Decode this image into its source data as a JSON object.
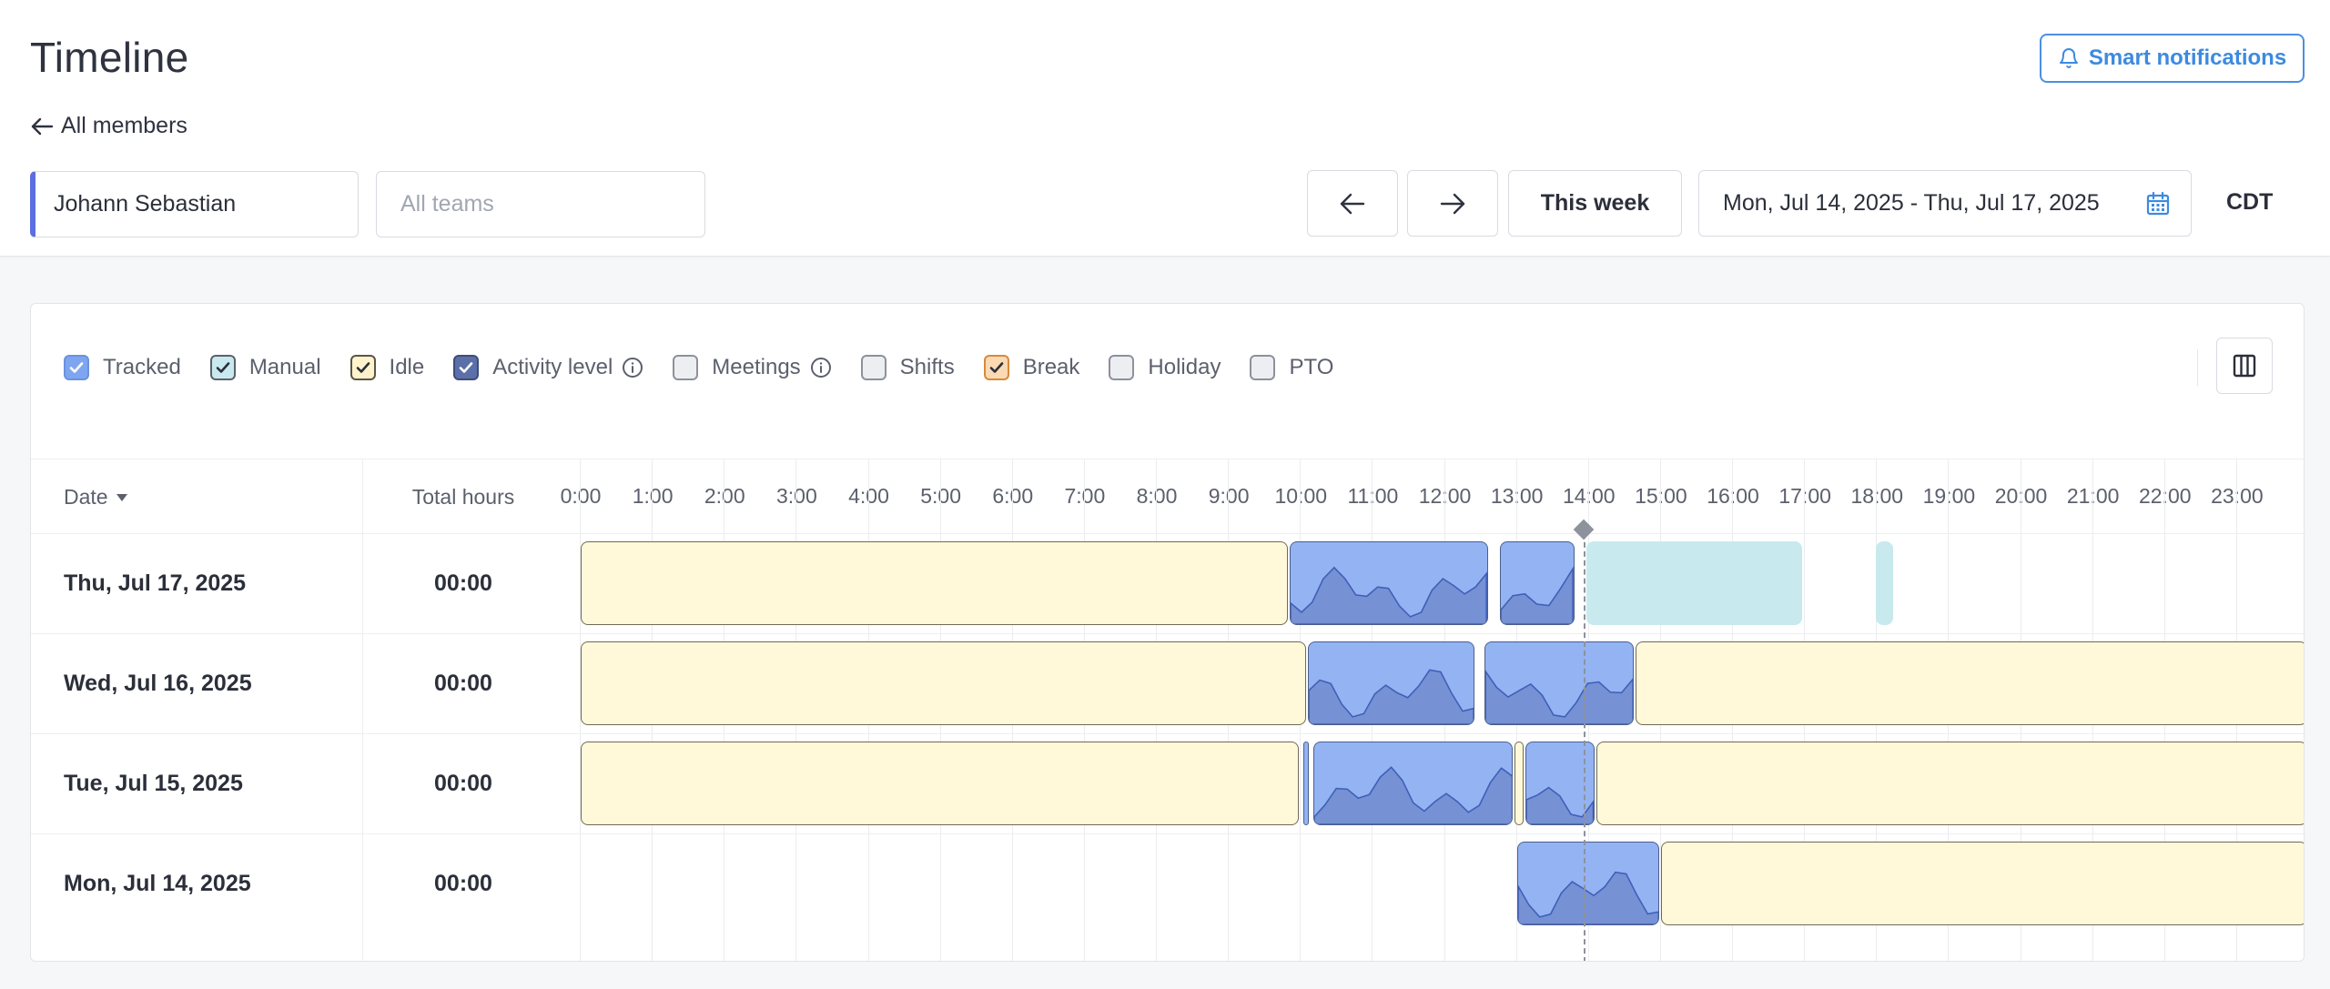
{
  "header": {
    "title": "Timeline",
    "smart_notifications_label": "Smart notifications",
    "back_link_label": "All members",
    "member_value": "Johann Sebastian",
    "teams_placeholder": "All teams",
    "this_week_label": "This week",
    "date_range": "Mon, Jul 14, 2025 - Thu, Jul 17, 2025",
    "timezone": "CDT"
  },
  "legend": {
    "items": [
      {
        "label": "Tracked",
        "checked": true,
        "color": "#7ea6f0"
      },
      {
        "label": "Manual",
        "checked": true,
        "color": "#c8eaee"
      },
      {
        "label": "Idle",
        "checked": true,
        "color": "#fff3cc"
      },
      {
        "label": "Activity level",
        "checked": true,
        "color": "#5b6fa8",
        "info": true
      },
      {
        "label": "Meetings",
        "checked": false,
        "info": true
      },
      {
        "label": "Shifts",
        "checked": false
      },
      {
        "label": "Break",
        "checked": true,
        "color": "#fbd9b3"
      },
      {
        "label": "Holiday",
        "checked": false
      },
      {
        "label": "PTO",
        "checked": false
      }
    ]
  },
  "table": {
    "date_header": "Date",
    "total_header": "Total hours",
    "hours": [
      "0:00",
      "1:00",
      "2:00",
      "3:00",
      "4:00",
      "5:00",
      "6:00",
      "7:00",
      "8:00",
      "9:00",
      "10:00",
      "11:00",
      "12:00",
      "13:00",
      "14:00",
      "15:00",
      "16:00",
      "17:00",
      "18:00",
      "19:00",
      "20:00",
      "21:00",
      "22:00",
      "23:00"
    ],
    "rows": [
      {
        "date": "Thu, Jul 17, 2025",
        "total": "00:00",
        "segments": [
          {
            "type": "idle",
            "start": 0.0,
            "end": 9.85
          },
          {
            "type": "tracked",
            "start": 9.85,
            "end": 12.62
          },
          {
            "type": "tracked",
            "start": 12.77,
            "end": 13.82
          },
          {
            "type": "manual",
            "start": 13.96,
            "end": 16.98
          },
          {
            "type": "manual",
            "start": 17.98,
            "end": 18.25
          }
        ]
      },
      {
        "date": "Wed, Jul 16, 2025",
        "total": "00:00",
        "segments": [
          {
            "type": "idle",
            "start": 0.0,
            "end": 10.1
          },
          {
            "type": "tracked",
            "start": 10.1,
            "end": 12.44
          },
          {
            "type": "tracked",
            "start": 12.55,
            "end": 14.65
          },
          {
            "type": "idle",
            "start": 14.65,
            "end": 24.0
          }
        ]
      },
      {
        "date": "Tue, Jul 15, 2025",
        "total": "00:00",
        "segments": [
          {
            "type": "idle",
            "start": 0.0,
            "end": 10.0
          },
          {
            "type": "tracked",
            "start": 10.04,
            "end": 10.12
          },
          {
            "type": "tracked",
            "start": 10.17,
            "end": 12.97
          },
          {
            "type": "idle",
            "start": 12.97,
            "end": 13.12
          },
          {
            "type": "tracked",
            "start": 13.12,
            "end": 14.1
          },
          {
            "type": "idle",
            "start": 14.1,
            "end": 24.0
          }
        ]
      },
      {
        "date": "Mon, Jul 14, 2025",
        "total": "00:00",
        "segments": [
          {
            "type": "tracked",
            "start": 13.0,
            "end": 15.0
          },
          {
            "type": "idle",
            "start": 15.0,
            "end": 24.0
          }
        ]
      }
    ]
  }
}
